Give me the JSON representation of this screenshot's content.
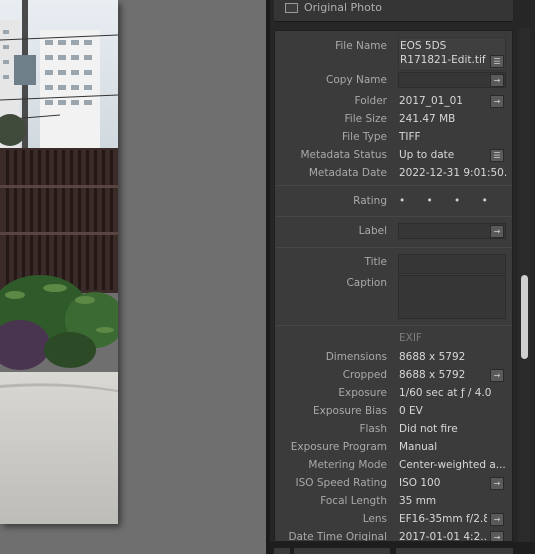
{
  "panel": {
    "original_photo_label": "Original Photo"
  },
  "metadata": {
    "file_name_label": "File Name",
    "file_name_line1": "EOS 5DS",
    "file_name_line2": "R171821-Edit.tif",
    "copy_name_label": "Copy Name",
    "folder_label": "Folder",
    "folder_value": "2017_01_01",
    "file_size_label": "File Size",
    "file_size_value": "241.47 MB",
    "file_type_label": "File Type",
    "file_type_value": "TIFF",
    "metadata_status_label": "Metadata Status",
    "metadata_status_value": "Up to date",
    "metadata_date_label": "Metadata Date",
    "metadata_date_value": "2022-12-31 9:01:50...",
    "rating_label": "Rating",
    "rating_value": "• • • • •",
    "label_label": "Label",
    "title_label": "Title",
    "caption_label": "Caption"
  },
  "exif": {
    "heading": "EXIF",
    "rows": [
      {
        "label": "Dimensions",
        "value": "8688 x 5792"
      },
      {
        "label": "Cropped",
        "value": "8688 x 5792"
      },
      {
        "label": "Exposure",
        "value": "1/60 sec at ƒ / 4.0"
      },
      {
        "label": "Exposure Bias",
        "value": "0 EV"
      },
      {
        "label": "Flash",
        "value": "Did not fire"
      },
      {
        "label": "Exposure Program",
        "value": "Manual"
      },
      {
        "label": "Metering Mode",
        "value": "Center-weighted a..."
      },
      {
        "label": "ISO Speed Rating",
        "value": "ISO 100"
      },
      {
        "label": "Focal Length",
        "value": "35 mm"
      },
      {
        "label": "Lens",
        "value": "EF16-35mm f/2.8"
      },
      {
        "label": "Date Time Original",
        "value": "2017-01-01 4:2..."
      }
    ]
  },
  "icons": {
    "list": "list-icon",
    "arrow": "arrow-right-icon",
    "checkbox": "checkbox-icon"
  }
}
